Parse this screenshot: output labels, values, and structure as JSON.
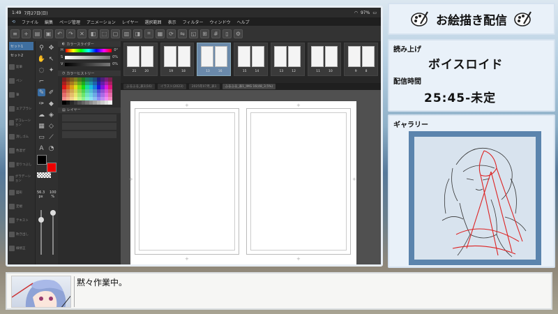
{
  "tablet": {
    "time": "1:49",
    "date": "7月27日(日)",
    "battery": "97%"
  },
  "menu": [
    "ファイル",
    "編集",
    "ページ管理",
    "アニメーション",
    "レイヤー",
    "選択範囲",
    "表示",
    "フィルター",
    "ウィンドウ",
    "ヘルプ"
  ],
  "left_panel": {
    "tabs": [
      "セット1",
      "セット2"
    ],
    "items": [
      "鉛筆",
      "ペン",
      "筆",
      "エアブラシ",
      "デコレーション",
      "消しゴム",
      "色混ぜ",
      "塗りつぶし",
      "グラデーション",
      "図形",
      "定規",
      "テキスト",
      "吹き出し",
      "線修正"
    ]
  },
  "brush": {
    "size": "56.3",
    "size_unit": "px",
    "opacity": "100",
    "opacity_unit": "%"
  },
  "color_slider": {
    "title": "カラースライダー",
    "rows": [
      {
        "label": "H",
        "value": "0°"
      },
      {
        "label": "S",
        "value": "0%"
      },
      {
        "label": "V",
        "value": "0%"
      }
    ]
  },
  "color_history": {
    "title": "カラーヒストリー"
  },
  "layer_panel": {
    "title": "レイヤー"
  },
  "page_strip": [
    {
      "left": "21",
      "right": "20",
      "selected": false
    },
    {
      "left": "19",
      "right": "18",
      "selected": false
    },
    {
      "left": "13",
      "right": "16",
      "selected": true
    },
    {
      "left": "15",
      "right": "14",
      "selected": false
    },
    {
      "left": "13",
      "right": "12",
      "selected": false
    },
    {
      "left": "11",
      "right": "10",
      "selected": false
    },
    {
      "left": "9",
      "right": "8",
      "selected": false
    }
  ],
  "doc_tabs": [
    "ふるふる_表1(16)",
    "イラスト(2023)",
    "2025年07月_表1",
    "ふるふる_表1_IMG 16(48_3.5%)"
  ],
  "stream": {
    "title": "お絵描き配信",
    "reading_label": "読み上げ",
    "reading_value": "ボイスロイド",
    "time_label": "配信時間",
    "time_value": "25:45-未定",
    "gallery_label": "ギャラリー"
  },
  "chat": {
    "message": "黙々作業中。"
  },
  "colors": {
    "accent": "#3a6ea5",
    "gallery_bg": "#5b84ad",
    "panel_bg": "#e9f1f9"
  }
}
